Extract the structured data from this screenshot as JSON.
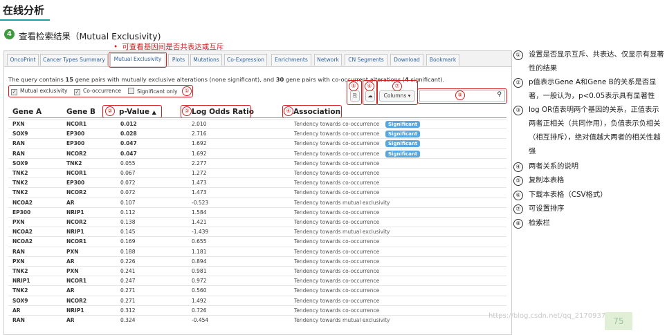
{
  "page": {
    "heading": "在线分析",
    "step_number": "4",
    "step_title": "查看检索结果（Mutual Exclusivity)",
    "note": "可查看基因间是否共表达或互斥",
    "note_dot": "•"
  },
  "tabs": [
    {
      "label": "OncoPrint"
    },
    {
      "label": "Cancer Types Summary"
    },
    {
      "label": "Mutual Exclusivity",
      "active": true
    },
    {
      "label": "Plots"
    },
    {
      "label": "Mutations"
    },
    {
      "label": "Co-Expression"
    },
    {
      "label": "Enrichments"
    },
    {
      "label": "Network"
    },
    {
      "label": "CN Segments"
    },
    {
      "label": "Download"
    },
    {
      "label": "Bookmark"
    }
  ],
  "summary": {
    "text_1": "The query contains ",
    "mutual_count": "15",
    "text_2": " gene pairs with mutually exclusive alterations (none significant), and ",
    "cooccur_count": "30",
    "text_3": " gene pairs with co-occurrent alterations (",
    "sig_count": "4",
    "text_4": " significant)."
  },
  "options": [
    {
      "label": "Mutual exclusivity",
      "checked": true
    },
    {
      "label": "Co-occurrence",
      "checked": true
    },
    {
      "label": "Significant only",
      "checked": false
    }
  ],
  "toolbar": {
    "copy_icon": "copy-icon",
    "download_icon": "cloud-download-icon",
    "columns_label": "Columns",
    "search_icon": "magnifier-icon"
  },
  "markers": [
    "①",
    "②",
    "③",
    "④",
    "⑤",
    "⑥",
    "⑦",
    "⑧"
  ],
  "table": {
    "headers": {
      "gene_a": "Gene A",
      "gene_b": "Gene B",
      "pvalue": "p-Value",
      "pvalue_sort": "▲",
      "log_odds": "Log Odds Ratio",
      "association": "Association"
    },
    "rows": [
      {
        "a": "PXN",
        "b": "NCOR1",
        "p": "0.012",
        "lor": "2.010",
        "assoc": "Tendency towards co-occurrence",
        "sig": "Significant"
      },
      {
        "a": "SOX9",
        "b": "EP300",
        "p": "0.028",
        "lor": "2.716",
        "assoc": "Tendency towards co-occurrence",
        "sig": "Significant"
      },
      {
        "a": "RAN",
        "b": "EP300",
        "p": "0.047",
        "lor": "1.692",
        "assoc": "Tendency towards co-occurrence",
        "sig": "Significant"
      },
      {
        "a": "RAN",
        "b": "NCOR2",
        "p": "0.047",
        "lor": "1.692",
        "assoc": "Tendency towards co-occurrence",
        "sig": "Significant"
      },
      {
        "a": "SOX9",
        "b": "TNK2",
        "p": "0.055",
        "lor": "2.277",
        "assoc": "Tendency towards co-occurrence",
        "sig": ""
      },
      {
        "a": "TNK2",
        "b": "NCOR1",
        "p": "0.067",
        "lor": "1.272",
        "assoc": "Tendency towards co-occurrence",
        "sig": ""
      },
      {
        "a": "TNK2",
        "b": "EP300",
        "p": "0.072",
        "lor": "1.473",
        "assoc": "Tendency towards co-occurrence",
        "sig": ""
      },
      {
        "a": "TNK2",
        "b": "NCOR2",
        "p": "0.072",
        "lor": "1.473",
        "assoc": "Tendency towards co-occurrence",
        "sig": ""
      },
      {
        "a": "NCOA2",
        "b": "AR",
        "p": "0.107",
        "lor": "-0.523",
        "assoc": "Tendency towards mutual exclusivity",
        "sig": ""
      },
      {
        "a": "EP300",
        "b": "NRIP1",
        "p": "0.112",
        "lor": "1.584",
        "assoc": "Tendency towards co-occurrence",
        "sig": ""
      },
      {
        "a": "PXN",
        "b": "NCOR2",
        "p": "0.138",
        "lor": "1.421",
        "assoc": "Tendency towards co-occurrence",
        "sig": ""
      },
      {
        "a": "NCOA2",
        "b": "NRIP1",
        "p": "0.145",
        "lor": "-1.439",
        "assoc": "Tendency towards mutual exclusivity",
        "sig": ""
      },
      {
        "a": "NCOA2",
        "b": "NCOR1",
        "p": "0.169",
        "lor": "0.655",
        "assoc": "Tendency towards co-occurrence",
        "sig": ""
      },
      {
        "a": "RAN",
        "b": "PXN",
        "p": "0.188",
        "lor": "1.181",
        "assoc": "Tendency towards co-occurrence",
        "sig": ""
      },
      {
        "a": "PXN",
        "b": "AR",
        "p": "0.226",
        "lor": "0.894",
        "assoc": "Tendency towards co-occurrence",
        "sig": ""
      },
      {
        "a": "TNK2",
        "b": "PXN",
        "p": "0.241",
        "lor": "0.981",
        "assoc": "Tendency towards co-occurrence",
        "sig": ""
      },
      {
        "a": "NRIP1",
        "b": "NCOR1",
        "p": "0.247",
        "lor": "0.972",
        "assoc": "Tendency towards co-occurrence",
        "sig": ""
      },
      {
        "a": "TNK2",
        "b": "AR",
        "p": "0.271",
        "lor": "0.560",
        "assoc": "Tendency towards co-occurrence",
        "sig": ""
      },
      {
        "a": "SOX9",
        "b": "NCOR2",
        "p": "0.271",
        "lor": "1.492",
        "assoc": "Tendency towards co-occurrence",
        "sig": ""
      },
      {
        "a": "AR",
        "b": "NRIP1",
        "p": "0.312",
        "lor": "0.726",
        "assoc": "Tendency towards co-occurrence",
        "sig": ""
      },
      {
        "a": "RAN",
        "b": "AR",
        "p": "0.324",
        "lor": "-0.454",
        "assoc": "Tendency towards mutual exclusivity",
        "sig": ""
      }
    ]
  },
  "legend": [
    {
      "num": "①",
      "text": "设置是否显示互斥、共表达、仅显示有显著性的结果"
    },
    {
      "num": "②",
      "text": "p值表示Gene A和Gene B的关系是否显著，一般认为，p<0.05表示具有显著性"
    },
    {
      "num": "③",
      "text": "log OR值表明两个基因的关系，正值表示两者正相关（共同作用），负值表示负相关（相互排斥），绝对值越大两者的相关性越强"
    },
    {
      "num": "④",
      "text": "两者关系的说明"
    },
    {
      "num": "⑤",
      "text": "复制本表格"
    },
    {
      "num": "⑥",
      "text": "下载本表格（CSV格式）"
    },
    {
      "num": "⑦",
      "text": "可设置排序"
    },
    {
      "num": "⑧",
      "text": "检索栏"
    }
  ],
  "watermark": "https://blog.csdn.net/qq_21709378",
  "page_number": "75",
  "colors": {
    "accent": "#1aa0a0",
    "annotation_red": "#d62020",
    "badge_blue": "#5aa6df",
    "step_green": "#3c9a3c"
  }
}
